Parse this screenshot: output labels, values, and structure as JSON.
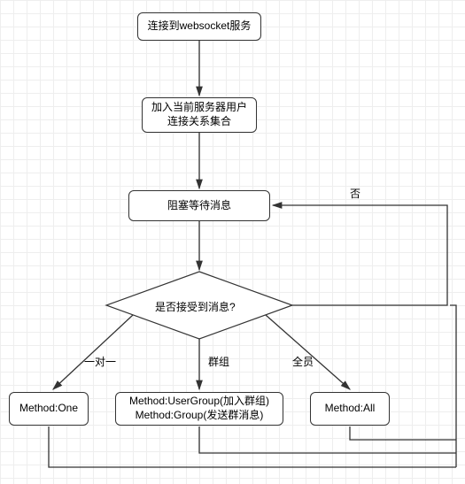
{
  "chart_data": {
    "type": "flowchart",
    "nodes": [
      {
        "id": "n1",
        "label": "连接到websocket服务"
      },
      {
        "id": "n2",
        "label": "加入当前服务器用户\n连接关系集合"
      },
      {
        "id": "n3",
        "label": "阻塞等待消息"
      },
      {
        "id": "d1",
        "label": "是否接受到消息?"
      },
      {
        "id": "m1",
        "label": "Method:One"
      },
      {
        "id": "m2",
        "label": "Method:UserGroup(加入群组)\nMethod:Group(发送群消息)"
      },
      {
        "id": "m3",
        "label": "Method:All"
      }
    ],
    "edges": [
      {
        "from": "n1",
        "to": "n2"
      },
      {
        "from": "n2",
        "to": "n3"
      },
      {
        "from": "n3",
        "to": "d1"
      },
      {
        "from": "d1",
        "to": "n3",
        "label": "否"
      },
      {
        "from": "d1",
        "to": "m1",
        "label": "一对一"
      },
      {
        "from": "d1",
        "to": "m2",
        "label": "群组"
      },
      {
        "from": "d1",
        "to": "m3",
        "label": "全员"
      },
      {
        "from": "m1",
        "to": "n3"
      },
      {
        "from": "m2",
        "to": "n3"
      },
      {
        "from": "m3",
        "to": "n3"
      }
    ]
  },
  "nodes": {
    "n1": "连接到websocket服务",
    "n2_line1": "加入当前服务器用户",
    "n2_line2": "连接关系集合",
    "n3": "阻塞等待消息",
    "d1": "是否接受到消息?",
    "m1": "Method:One",
    "m2_line1": "Method:UserGroup(加入群组)",
    "m2_line2": "Method:Group(发送群消息)",
    "m3": "Method:All"
  },
  "labels": {
    "no": "否",
    "one": "一对一",
    "group": "群组",
    "all": "全员"
  }
}
